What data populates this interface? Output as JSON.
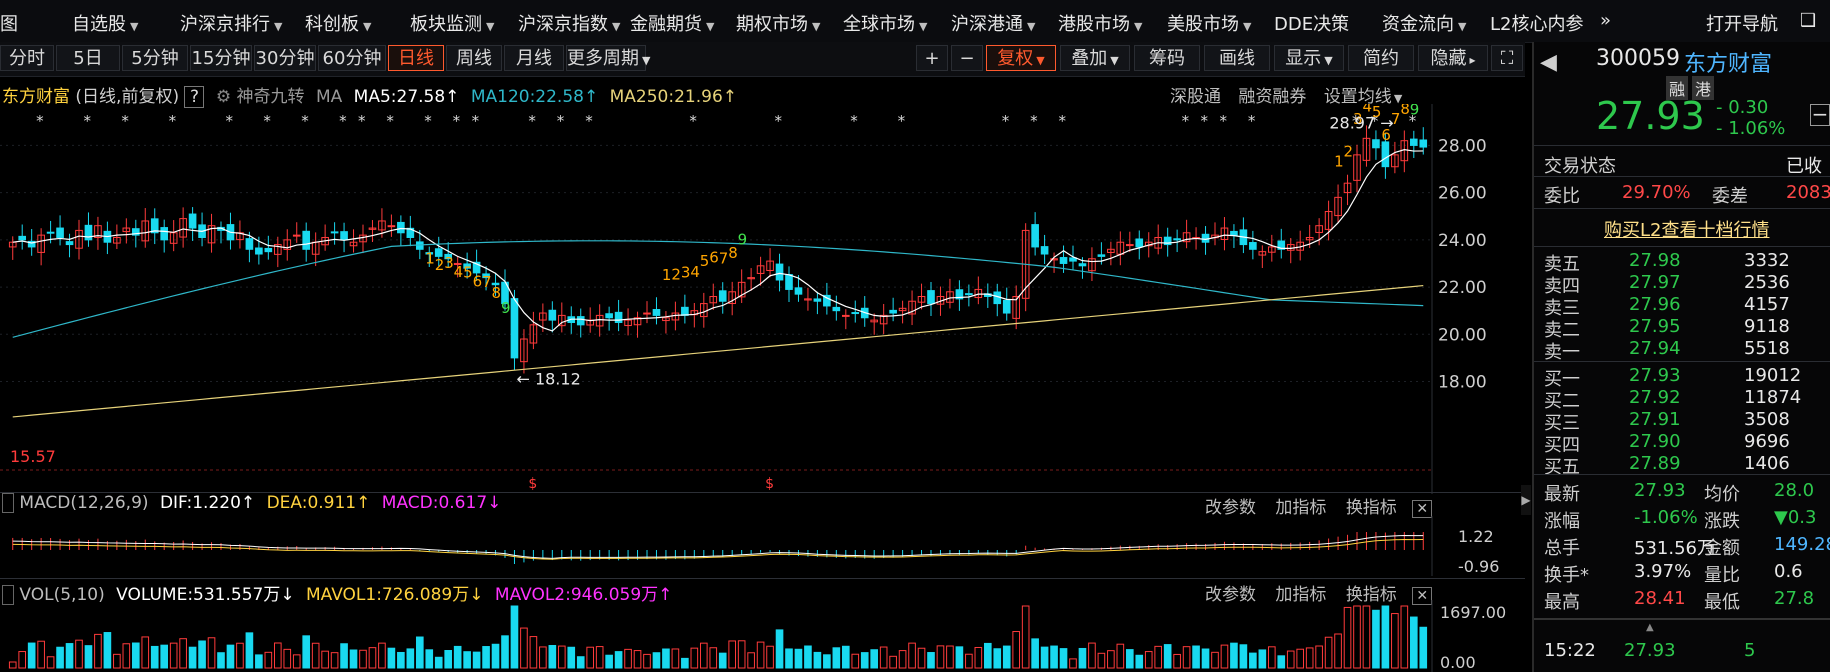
{
  "nav": {
    "items": [
      {
        "label": "图",
        "caret": false
      },
      {
        "label": "自选股",
        "caret": true
      },
      {
        "label": "沪深京排行",
        "caret": true
      },
      {
        "label": "科创板",
        "caret": true
      },
      {
        "label": "板块监测",
        "caret": true
      },
      {
        "label": "沪深京指数",
        "caret": true
      },
      {
        "label": "金融期货",
        "caret": true
      },
      {
        "label": "期权市场",
        "caret": true
      },
      {
        "label": "全球市场",
        "caret": true
      },
      {
        "label": "沪深港通",
        "caret": true
      },
      {
        "label": "港股市场",
        "caret": true
      },
      {
        "label": "美股市场",
        "caret": true
      },
      {
        "label": "DDE决策",
        "caret": false
      },
      {
        "label": "资金流向",
        "caret": true
      },
      {
        "label": "L2核心内参",
        "caret": false
      }
    ],
    "more_icon": "»",
    "open_nav": "打开导航",
    "extra": "❑"
  },
  "toolbar": {
    "periods": [
      "分时",
      "5日",
      "5分钟",
      "15分钟",
      "30分钟",
      "60分钟",
      "日线",
      "周线",
      "月线",
      "更多周期"
    ],
    "active_period": "日线",
    "zoom_in": "+",
    "zoom_out": "−",
    "restore": "复权",
    "overlay": "叠加",
    "chips": "筹码",
    "draw": "画线",
    "display": "显示",
    "simple": "简约",
    "hide": "隐藏",
    "expand_icon": "⛶"
  },
  "chart_header": {
    "name": "东方财富",
    "mode": "(日线,前复权)",
    "help": "?",
    "nine": "神奇九转",
    "ma": "MA",
    "ma5": "MA5:27.58",
    "ma120": "MA120:22.58",
    "ma250": "MA250:21.96",
    "links": [
      "深股通",
      "融资融券",
      "设置均线"
    ]
  },
  "chart_data": {
    "type": "candlestick",
    "price_ticks": [
      "28.00",
      "26.00",
      "24.00",
      "22.00",
      "20.00",
      "18.00"
    ],
    "ylim": [
      16.2,
      29.5
    ],
    "high_label": "28.97",
    "low_label": "18.12",
    "base_label": "15.57",
    "td_seq1": [
      "1",
      "2",
      "3",
      "4",
      "5",
      "6",
      "7",
      "8",
      "9"
    ],
    "td_seq2": [
      "1",
      "2",
      "3",
      "4",
      "5",
      "6",
      "7",
      "8",
      "9"
    ],
    "td_seq3": [
      "1",
      "2",
      "3",
      "4",
      "5",
      "6",
      "7",
      "8",
      "9"
    ],
    "closes": [
      23.9,
      24.0,
      23.7,
      24.2,
      24.3,
      24.1,
      23.8,
      24.4,
      24.0,
      24.6,
      23.9,
      24.1,
      24.5,
      24.2,
      24.8,
      24.3,
      24.0,
      24.3,
      24.9,
      24.5,
      24.1,
      24.6,
      24.4,
      24.0,
      24.3,
      23.6,
      23.4,
      23.5,
      23.8,
      24.0,
      24.2,
      23.6,
      23.9,
      24.1,
      24.3,
      24.0,
      23.9,
      24.2,
      24.5,
      24.8,
      24.6,
      24.3,
      24.1,
      23.6,
      23.4,
      23.3,
      23.2,
      23.0,
      22.8,
      22.6,
      22.4,
      22.1,
      21.3,
      19.0,
      19.8,
      20.4,
      20.9,
      20.6,
      20.8,
      20.5,
      20.4,
      20.6,
      20.8,
      20.7,
      20.5,
      20.6,
      20.7,
      20.9,
      20.8,
      20.7,
      20.9,
      20.8,
      21.0,
      21.3,
      21.6,
      21.4,
      21.8,
      22.2,
      22.4,
      22.9,
      23.1,
      22.3,
      21.9,
      21.7,
      21.5,
      21.4,
      21.2,
      21.0,
      20.8,
      20.9,
      20.7,
      20.6,
      20.8,
      20.9,
      21.1,
      21.4,
      21.6,
      21.3,
      21.6,
      21.8,
      21.5,
      21.7,
      21.9,
      21.6,
      21.3,
      20.9,
      21.6,
      24.4,
      23.7,
      23.4,
      23.2,
      23.0,
      23.1,
      22.9,
      23.2,
      23.3,
      23.6,
      23.9,
      23.8,
      23.7,
      23.9,
      24.1,
      23.8,
      24.0,
      24.3,
      24.1,
      23.9,
      24.2,
      24.5,
      24.2,
      23.8,
      23.6,
      23.5,
      23.7,
      23.6,
      23.8,
      23.9,
      24.1,
      24.6,
      25.2,
      25.8,
      26.4,
      27.6,
      28.3,
      27.9,
      27.1,
      27.6,
      28.2,
      28.0,
      27.93
    ],
    "macd_ticks": [
      "1.22",
      "-0.96"
    ],
    "vol_ticks": [
      "1697.00",
      "0.00"
    ]
  },
  "macd": {
    "name": "MACD(12,26,9)",
    "dif": "DIF:1.220",
    "dea": "DEA:0.911",
    "macd": "MACD:0.617",
    "actions": [
      "改参数",
      "加指标",
      "换指标"
    ],
    "close": "✕"
  },
  "vol": {
    "name": "VOL(5,10)",
    "volume": "VOLUME:531.557万",
    "mavol1": "MAVOL1:726.089万",
    "mavol2": "MAVOL2:946.059万",
    "actions": [
      "改参数",
      "加指标",
      "换指标"
    ],
    "close": "✕"
  },
  "quote": {
    "back_icon": "◀",
    "code": "300059",
    "name": "东方财富",
    "tags": [
      "融",
      "港"
    ],
    "price": "27.93",
    "change": "- 0.30",
    "change_pct": "- 1.06%",
    "minus_icon": "−",
    "trade_status_label": "交易状态",
    "trade_status_value": "已收",
    "wb_label": "委比",
    "wb_value": "29.70%",
    "wc_label": "委差",
    "wc_value": "2083",
    "l2_link": "购买L2查看十档行情",
    "asks": [
      {
        "label": "卖五",
        "price": "27.98",
        "vol": "3332"
      },
      {
        "label": "卖四",
        "price": "27.97",
        "vol": "2536"
      },
      {
        "label": "卖三",
        "price": "27.96",
        "vol": "4157"
      },
      {
        "label": "卖二",
        "price": "27.95",
        "vol": "9118"
      },
      {
        "label": "卖一",
        "price": "27.94",
        "vol": "5518"
      }
    ],
    "bids": [
      {
        "label": "买一",
        "price": "27.93",
        "vol": "19012"
      },
      {
        "label": "买二",
        "price": "27.92",
        "vol": "11874"
      },
      {
        "label": "买三",
        "price": "27.91",
        "vol": "3508"
      },
      {
        "label": "买四",
        "price": "27.90",
        "vol": "9696"
      },
      {
        "label": "买五",
        "price": "27.89",
        "vol": "1406"
      }
    ],
    "stats": [
      {
        "l1": "最新",
        "v1": "27.93",
        "l2": "均价",
        "v2": "28.0"
      },
      {
        "l1": "涨幅",
        "v1": "-1.06%",
        "l2": "涨跌",
        "v2": "▼0.3"
      },
      {
        "l1": "总手",
        "v1": "531.56万",
        "l2": "金额",
        "v2": "149.28"
      },
      {
        "l1": "换手*",
        "v1": "3.97%",
        "l2": "量比",
        "v2": "0.6"
      },
      {
        "l1": "最高",
        "v1": "28.41",
        "l2": "最低",
        "v2": "27.8"
      }
    ],
    "tick_time": "15:22",
    "tick_price": "27.93",
    "tick_vol": "5",
    "collapse_icon": "▲",
    "side_toggle_icon": "▶"
  },
  "colors": {
    "up": "#ff3b3b",
    "down": "#19d9f0",
    "ma5": "#ffffff",
    "ma120": "#2fb7c9",
    "ma250": "#e6d27a",
    "td": "#ffa500",
    "td_last": "#41e04d",
    "accent": "#ff5a2e"
  }
}
